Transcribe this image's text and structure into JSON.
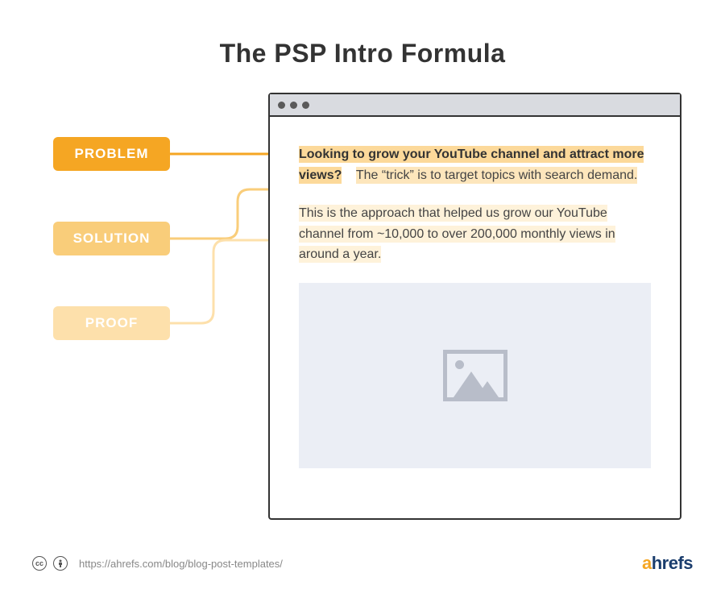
{
  "title": "The PSP Intro Formula",
  "labels": {
    "problem": "PROBLEM",
    "solution": "SOLUTION",
    "proof": "PROOF"
  },
  "content": {
    "problem_text": "Looking to grow your YouTube channel and attract more views?",
    "solution_text": "The “trick” is to target topics with search demand.",
    "proof_text": "This is the approach that helped us grow our YouTube channel from ~10,000 to over 200,000 monthly views in around a year."
  },
  "footer": {
    "url": "https://ahrefs.com/blog/blog-post-templates/",
    "brand": "ahrefs"
  },
  "colors": {
    "problem": "#f5a623",
    "solution": "#f9cd7a",
    "proof": "#fde0ab"
  }
}
